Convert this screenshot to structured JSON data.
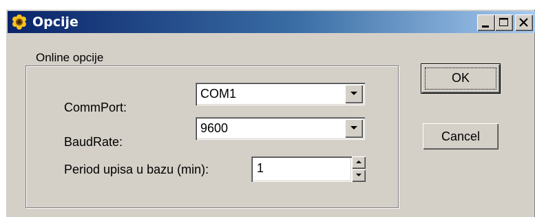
{
  "window": {
    "title": "Opcije",
    "icon": "sunflower-app-icon",
    "controls": [
      "minimize-icon",
      "maximize-icon",
      "close-icon"
    ]
  },
  "group": {
    "label": "Online opcije"
  },
  "fields": {
    "commport": {
      "label": "CommPort:",
      "value": "COM1"
    },
    "baudrate": {
      "label": "BaudRate:",
      "value": "9600"
    },
    "period": {
      "label": "Period upisa u bazu (min):",
      "value": "1"
    }
  },
  "buttons": {
    "ok": "OK",
    "cancel": "Cancel"
  },
  "colors": {
    "titlebar_start": "#0a246a",
    "titlebar_end": "#a6caf0",
    "face": "#d4d0c8"
  }
}
